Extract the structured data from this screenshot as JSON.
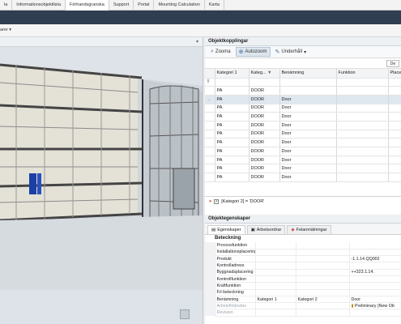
{
  "tabs": [
    "la",
    "Informationsobjektlista",
    "Förhandsgranska",
    "Support",
    "Portal",
    "Mounting Calculation",
    "Karta"
  ],
  "active_tab_index": 2,
  "subtoolbar": {
    "layers_label": "arer ▾"
  },
  "objektkopplingar": {
    "title": "Objektkopplingar",
    "toolbar": {
      "zoom": "Zooma",
      "autozoom": "Autozoom",
      "underhall": "Underhåll"
    },
    "filter_button": "De",
    "columns": [
      "Kategori 1",
      "Kateg...",
      "Benämning",
      "Funktion",
      "Placer"
    ],
    "rows": [
      [
        "PA",
        "DOOR",
        ""
      ],
      [
        "PA",
        "DOOR",
        "Door"
      ],
      [
        "PA",
        "DOOR",
        "Door"
      ],
      [
        "PA",
        "DOOR",
        "Door"
      ],
      [
        "PA",
        "DOOR",
        "Door"
      ],
      [
        "PA",
        "DOOR",
        "Door"
      ],
      [
        "PA",
        "DOOR",
        "Door"
      ],
      [
        "PA",
        "DOOR",
        "Door"
      ],
      [
        "PA",
        "DOOR",
        "Door"
      ],
      [
        "PA",
        "DOOR",
        "Door"
      ],
      [
        "PA",
        "DOOR",
        "Door"
      ]
    ],
    "filter_text": "[Kategori 2] = 'DOOR'"
  },
  "objektegenskaper": {
    "title": "Objektegenskaper",
    "subtabs": [
      "Egenskaper",
      "Arbetsordrar",
      "Felanmälningar"
    ],
    "section": "Beteckning",
    "properties": [
      [
        "Processfunktion",
        "",
        "",
        ""
      ],
      [
        "Installationsplacering",
        "",
        "",
        ""
      ],
      [
        "Produkt",
        "",
        "",
        "-1.1.14.QQ002"
      ],
      [
        "Kontrolladress",
        "",
        "",
        ""
      ],
      [
        "Byggnadsplacering",
        "",
        "",
        "++323.1.14."
      ],
      [
        "Kontrollfunktion",
        "",
        "",
        ""
      ],
      [
        "Kraftfunktion",
        "",
        "",
        ""
      ],
      [
        "Fri beteckning",
        "",
        "",
        ""
      ],
      [
        "Benämning",
        "Kategori 1",
        "Kategori 2",
        "Door"
      ],
      [
        "Arbetsflödesfas",
        "",
        "",
        "Preliminary (New Ob"
      ],
      [
        "Revision",
        "",
        "",
        ""
      ]
    ]
  }
}
